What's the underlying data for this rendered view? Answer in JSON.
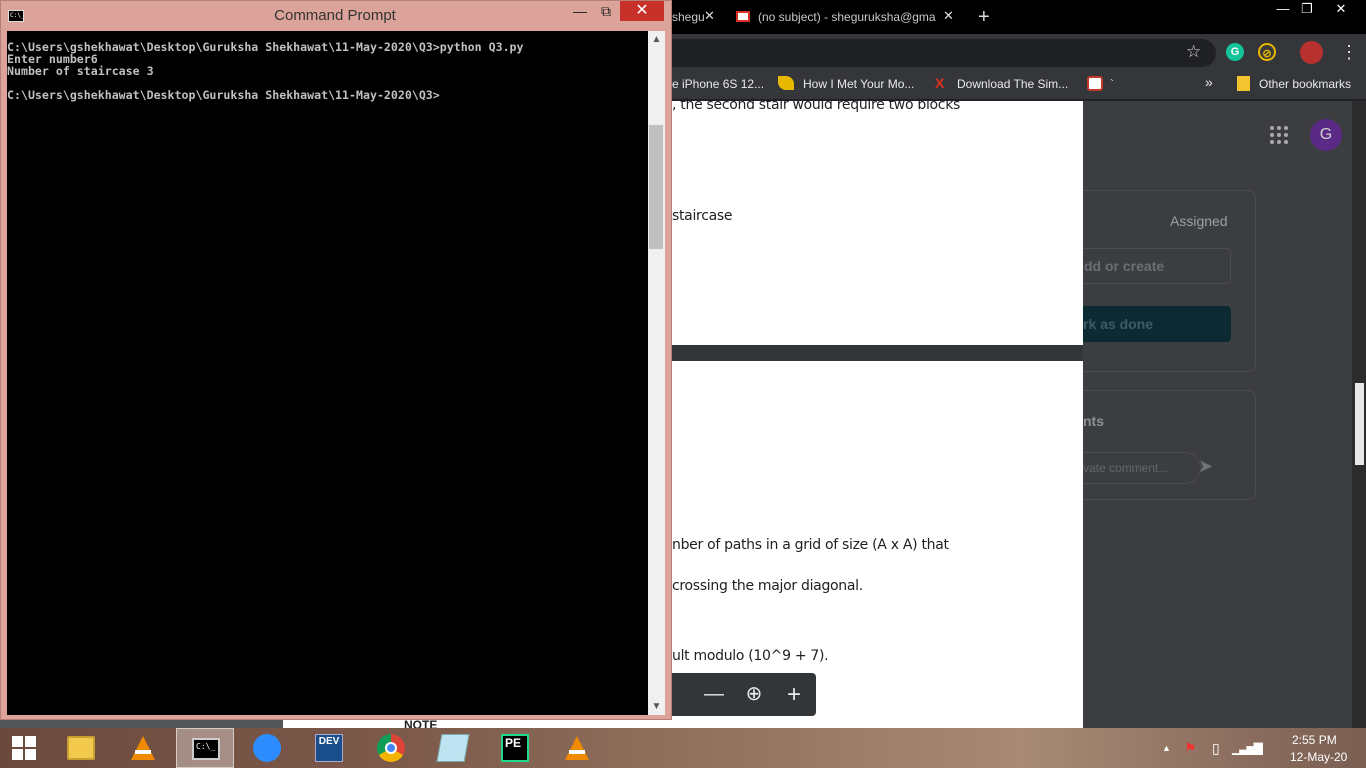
{
  "chrome": {
    "tabs": [
      {
        "label": "shegu",
        "close": "✕"
      },
      {
        "label": "(no subject) - sheguruksha@gma",
        "close": "✕"
      }
    ],
    "new_tab": "+",
    "window_controls": {
      "minimize": "—",
      "maximize": "❐",
      "close": "✕"
    },
    "extensions": [
      {
        "name": "grammarly-icon",
        "glyph": "G",
        "color": "#15c39a"
      },
      {
        "name": "extension-icon",
        "glyph": "⊘",
        "color": "#e6b800"
      }
    ],
    "menu": "⋮",
    "bookmarks": [
      {
        "icon": "",
        "label": "e iPhone 6S 12..."
      },
      {
        "icon": "",
        "label": "How I Met Your Mo..."
      },
      {
        "icon": "X",
        "label": "Download The Sim..."
      },
      {
        "icon": "",
        "label": "`"
      }
    ],
    "bookmarks_more": "»",
    "other_bookmarks": "Other bookmarks"
  },
  "classroom": {
    "avatar_letter": "G",
    "assigned": "Assigned",
    "add_or_create": "dd or create",
    "mark_as_done": "rk as done",
    "comments_title": "nts",
    "comment_placeholder": "vate comment..."
  },
  "pdf": {
    "page1_lines": [
      ", the second stair would require two blocks",
      "staircase"
    ],
    "page2_lines": [
      "nber of paths in a grid of size (A x A) that",
      " crossing the major diagonal.",
      "ult modulo (10^9 + 7)."
    ],
    "note": "NOTE",
    "zoom": {
      "out": "—",
      "fit": "⊕",
      "in": "+"
    }
  },
  "cmd": {
    "title": "Command Prompt",
    "icon_text": "C:\\_",
    "controls": {
      "minimize": "—",
      "maximize": "⧉",
      "close": "✕"
    },
    "lines": [
      "C:\\Users\\gshekhawat\\Desktop\\Guruksha Shekhawat\\11-May-2020\\Q3>python Q3.py",
      "Enter number6",
      "Number of staircase 3",
      "",
      "C:\\Users\\gshekhawat\\Desktop\\Guruksha Shekhawat\\11-May-2020\\Q3>"
    ],
    "scroll_up": "▲",
    "scroll_down": "▼"
  },
  "taskbar": {
    "apps": [
      {
        "name": "start-button"
      },
      {
        "name": "file-explorer"
      },
      {
        "name": "vlc-player"
      },
      {
        "name": "command-prompt",
        "active": true
      },
      {
        "name": "zoom"
      },
      {
        "name": "dev-cpp",
        "text": "DEV"
      },
      {
        "name": "chrome"
      },
      {
        "name": "notepad"
      },
      {
        "name": "pycharm-edu",
        "text": "PE"
      },
      {
        "name": "vlc-player-2"
      }
    ],
    "clock_time": "2:55 PM",
    "clock_date": "12-May-20"
  }
}
